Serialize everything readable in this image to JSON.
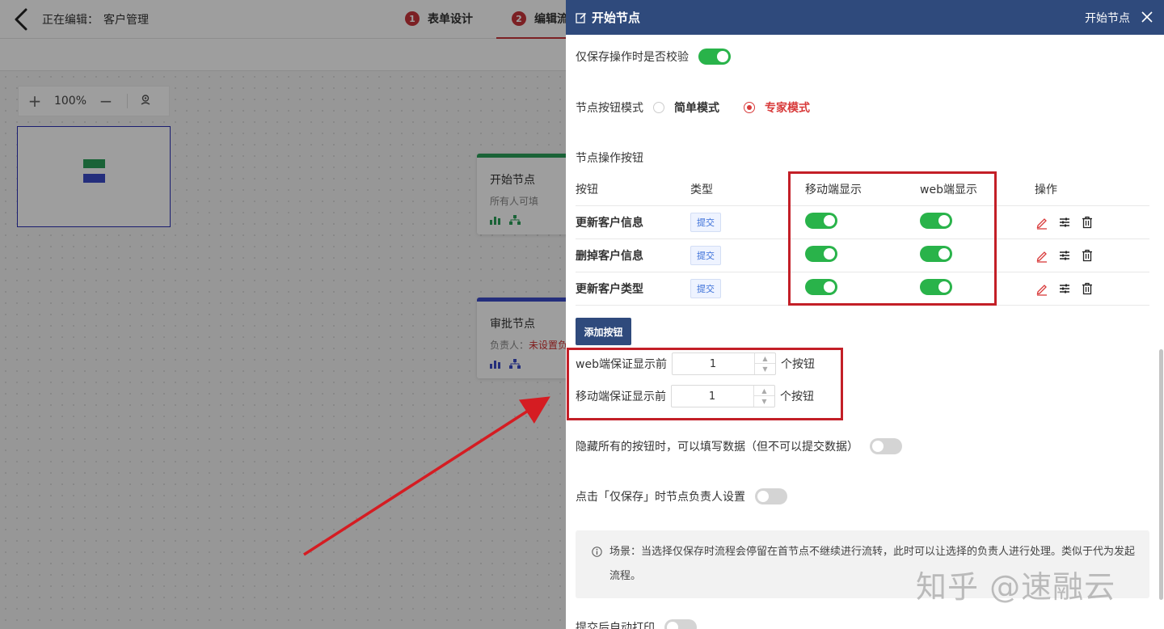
{
  "header": {
    "editing_label": "正在编辑：",
    "app_name": "客户管理",
    "steps": [
      {
        "num": "1",
        "label": "表单设计"
      },
      {
        "num": "2",
        "label": "编辑流"
      }
    ]
  },
  "canvas": {
    "zoom": "100%",
    "nodes": [
      {
        "title": "开始节点",
        "sub": "所有人可填"
      },
      {
        "title": "审批节点",
        "sub_label": "负责人：",
        "sub_warn": "未设置负"
      }
    ]
  },
  "drawer": {
    "title": "开始节点",
    "right_title": "开始节点",
    "validate_label": "仅保存操作时是否校验",
    "mode_label": "节点按钮模式",
    "mode_options": [
      "简单模式",
      "专家模式"
    ],
    "mode_selected": "专家模式",
    "ops_label": "节点操作按钮",
    "table": {
      "headers": [
        "按钮",
        "类型",
        "移动端显示",
        "web端显示",
        "操作"
      ],
      "rows": [
        {
          "name": "更新客户信息",
          "type": "提交",
          "mobile": true,
          "web": true
        },
        {
          "name": "删掉客户信息",
          "type": "提交",
          "mobile": true,
          "web": true
        },
        {
          "name": "更新客户类型",
          "type": "提交",
          "mobile": true,
          "web": true
        }
      ]
    },
    "add_button": "添加按钮",
    "web_min_label": "web端保证显示前",
    "web_min_value": "1",
    "mobile_min_label": "移动端保证显示前",
    "mobile_min_value": "1",
    "unit_suffix": "个按钮",
    "hide_all_label": "隐藏所有的按钮时，可以填写数据（但不可以提交数据）",
    "save_owner_label": "点击「仅保存」时节点负责人设置",
    "note_text": "场景：当选择仅保存时流程会停留在首节点不继续进行流转，此时可以让选择的负责人进行处理。类似于代为发起流程。",
    "bottom_label": "提交后自动打印"
  },
  "watermark": "知乎 @速融云",
  "colors": {
    "accent_red": "#c9343a",
    "drawer_header": "#2f4a7c",
    "toggle_on": "#29b34a",
    "highlight_box": "#c31f27"
  }
}
